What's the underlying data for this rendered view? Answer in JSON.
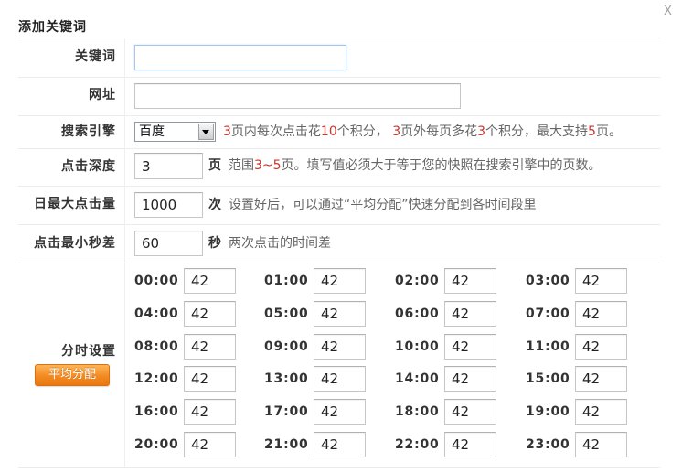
{
  "dialog": {
    "title": "添加关键词",
    "close_label": "X"
  },
  "form": {
    "keyword": {
      "label": "关键词",
      "value": ""
    },
    "url": {
      "label": "网址",
      "value": ""
    },
    "engine": {
      "label": "搜索引擎",
      "selected": "百度",
      "hint": [
        {
          "text": "3",
          "highlight": true
        },
        {
          "text": "页内每次点击花",
          "highlight": false
        },
        {
          "text": "10",
          "highlight": true
        },
        {
          "text": "个积分， ",
          "highlight": false
        },
        {
          "text": "3",
          "highlight": true
        },
        {
          "text": "页外每页多花",
          "highlight": false
        },
        {
          "text": "3",
          "highlight": true
        },
        {
          "text": "个积分，最大支持",
          "highlight": false
        },
        {
          "text": "5",
          "highlight": true
        },
        {
          "text": "页。",
          "highlight": false
        }
      ]
    },
    "depth": {
      "label": "点击深度",
      "value": "3",
      "unit": "页",
      "hint": [
        {
          "text": "范围",
          "highlight": false
        },
        {
          "text": "3~5",
          "highlight": true
        },
        {
          "text": "页。填写值必须大于等于您的快照在搜索引擎中的页数。",
          "highlight": false
        }
      ]
    },
    "daily_max": {
      "label": "日最大点击量",
      "value": "1000",
      "unit": "次",
      "hint": [
        {
          "text": "设置好后，可以通过“平均分配”快速分配到各时间段里",
          "highlight": false
        }
      ]
    },
    "min_interval": {
      "label": "点击最小秒差",
      "value": "60",
      "unit": "秒",
      "hint": [
        {
          "text": "两次点击的时间差",
          "highlight": false
        }
      ]
    }
  },
  "schedule": {
    "label": "分时设置",
    "distribute_button": "平均分配",
    "slots": [
      {
        "time": "00:00",
        "value": "42"
      },
      {
        "time": "01:00",
        "value": "42"
      },
      {
        "time": "02:00",
        "value": "42"
      },
      {
        "time": "03:00",
        "value": "42"
      },
      {
        "time": "04:00",
        "value": "42"
      },
      {
        "time": "05:00",
        "value": "42"
      },
      {
        "time": "06:00",
        "value": "42"
      },
      {
        "time": "07:00",
        "value": "42"
      },
      {
        "time": "08:00",
        "value": "42"
      },
      {
        "time": "09:00",
        "value": "42"
      },
      {
        "time": "10:00",
        "value": "42"
      },
      {
        "time": "11:00",
        "value": "42"
      },
      {
        "time": "12:00",
        "value": "42"
      },
      {
        "time": "13:00",
        "value": "42"
      },
      {
        "time": "14:00",
        "value": "42"
      },
      {
        "time": "15:00",
        "value": "42"
      },
      {
        "time": "16:00",
        "value": "42"
      },
      {
        "time": "17:00",
        "value": "42"
      },
      {
        "time": "18:00",
        "value": "42"
      },
      {
        "time": "19:00",
        "value": "42"
      },
      {
        "time": "20:00",
        "value": "42"
      },
      {
        "time": "21:00",
        "value": "42"
      },
      {
        "time": "22:00",
        "value": "42"
      },
      {
        "time": "23:00",
        "value": "42"
      }
    ]
  },
  "colors": {
    "highlight": "#d0332b",
    "button": "#f28a22",
    "focus_border": "#a3c6ea"
  }
}
